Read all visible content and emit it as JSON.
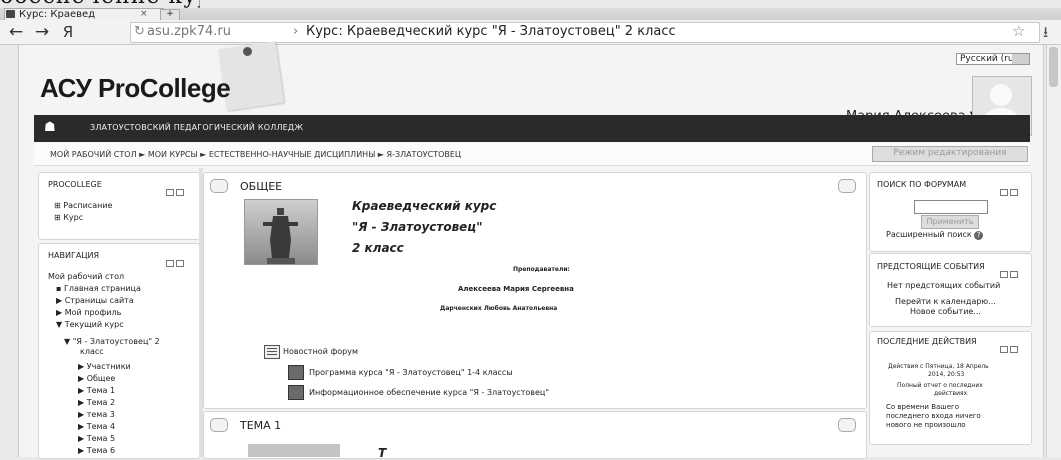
{
  "doc_fragment": "обеспечение курса.",
  "browser": {
    "tab_title": "Курс: Краевед",
    "tab_close": "×",
    "new_tab": "+",
    "back": "←",
    "forward": "→",
    "yandex": "Я",
    "reload": "↻",
    "url": "asu.zpk74.ru",
    "url_sep": "›",
    "url_title": "Курс: Краеведческий курс \"Я - Златоустовец\" 2 класс",
    "star": "☆",
    "download": "⭳"
  },
  "header": {
    "logo": "АСУ ProCollege",
    "language": "Русский (ru)",
    "user_name": "Мария Алексеева ▼"
  },
  "navbar": {
    "home_icon": "☗",
    "college": "ЗЛАТОУСТОВСКИЙ ПЕДАГОГИЧЕСКИЙ КОЛЛЕДЖ"
  },
  "breadcrumb": {
    "text": "МОЙ РАБОЧИЙ СТОЛ ► МОИ КУРСЫ ► ЕСТЕСТВЕННО-НАУЧНЫЕ ДИСЦИПЛИНЫ ► Я-ЗЛАТОУСТОВЕЦ",
    "edit_button": "Режим редактирования"
  },
  "left": {
    "procollege": {
      "title": "PROCOLLEGE",
      "items": [
        "Расписание",
        "Курс"
      ]
    },
    "navigation": {
      "title": "НАВИГАЦИЯ",
      "items": [
        "Мой рабочий стол",
        "Главная страница",
        "Страницы сайта",
        "Мой профиль",
        "Текущий курс",
        "\"Я - Златоустовец\" 2",
        "класс",
        "Участники",
        "Общее",
        "Тема 1",
        "Тема 2",
        "тема 3",
        "Тема 4",
        "Тема 5",
        "Тема 6"
      ]
    }
  },
  "main": {
    "section_general": "ОБЩЕЕ",
    "course_lines": [
      "Краеведческий курс",
      "\"Я - Златоустовец\"",
      "2 класс"
    ],
    "teachers_label": "Преподаватели:",
    "teacher_1": "Алексеева Мария Сергеевна",
    "teacher_2": "Дарченских Любовь Анатольевна",
    "forum": "Новостной форум",
    "resource_1": "Программа курса \"Я - Златоустовец\" 1-4 классы",
    "resource_2": "Информационное обеспечение курса \"Я - Златоустовец\"",
    "section_topic1": "ТЕМА 1",
    "topic1_title_start": "Т"
  },
  "right": {
    "forum_search": {
      "title": "ПОИСК ПО ФОРУМАМ",
      "button": "Применить",
      "advanced": "Расширенный поиск"
    },
    "events": {
      "title": "ПРЕДСТОЯЩИЕ СОБЫТИЯ",
      "none": "Нет предстоящих событий",
      "calendar": "Перейти к календарю...",
      "new_event": "Новое событие..."
    },
    "activity": {
      "title": "ПОСЛЕДНИЕ ДЕЙСТВИЯ",
      "since": "Действия с Пятница, 18 Апрель",
      "since2": "2014, 20:53",
      "report": "Полный отчет о последних",
      "report2": "действиях",
      "msg1": "Со времени Вашего",
      "msg2": "последнего входа ничего",
      "msg3": "нового не произошло"
    }
  }
}
